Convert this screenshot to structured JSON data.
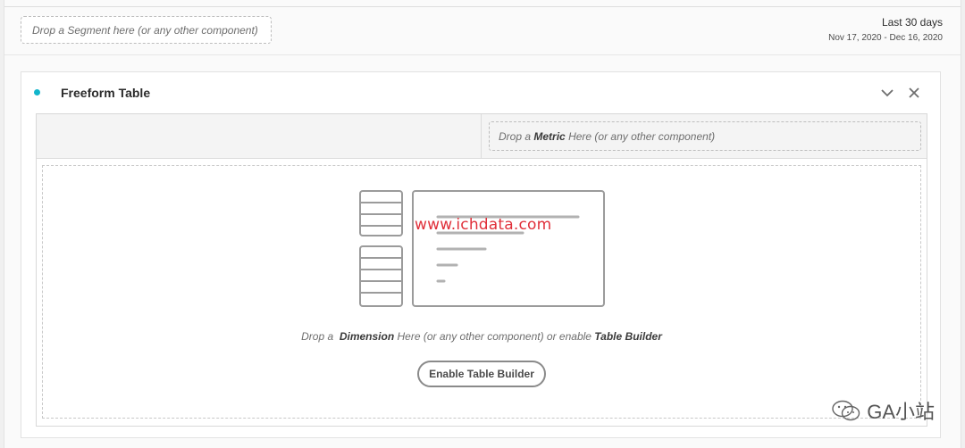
{
  "filters": {
    "segment_drop_text": "Drop a Segment here (or any other component)"
  },
  "date_range": {
    "label": "Last 30 days",
    "dates": "Nov 17, 2020 - Dec 16, 2020"
  },
  "panel": {
    "title": "Freeform Table",
    "accent_color": "#12b5cb",
    "icons": [
      "chevron-down-icon",
      "close-icon"
    ]
  },
  "table": {
    "metric_drop": {
      "prefix": "Drop a ",
      "strong": "Metric",
      "suffix": " Here (or any other component)"
    },
    "dimension_drop": {
      "prefix": "Drop a ",
      "strong": "Dimension",
      "middle": " Here (or any other component) or enable ",
      "strong2": "Table Builder"
    },
    "enable_button_label": "Enable Table Builder"
  },
  "watermarks": {
    "url": "www.ichdata.com",
    "wechat": "GA小站"
  }
}
